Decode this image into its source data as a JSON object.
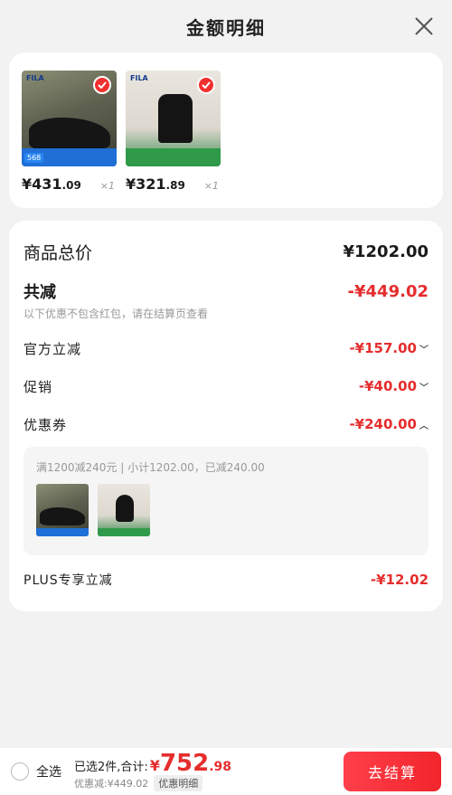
{
  "header": {
    "title": "金额明细"
  },
  "products": [
    {
      "brand": "FILA",
      "strip_tag": "568",
      "price_int": "¥431",
      "price_dec": ".09",
      "qty": "×1"
    },
    {
      "brand": "FILA",
      "strip_tag": "",
      "price_int": "¥321",
      "price_dec": ".89",
      "qty": "×1"
    }
  ],
  "summary": {
    "total_label": "商品总价",
    "total_value": "¥1202.00",
    "reduce_label": "共减",
    "reduce_value": "-¥449.02",
    "note": "以下优惠不包含红包，请在结算页查看",
    "official_label": "官方立减",
    "official_value": "-¥157.00",
    "promo_label": "促销",
    "promo_value": "-¥40.00",
    "coupon_label": "优惠券",
    "coupon_value": "-¥240.00",
    "coupon_detail": "满1200减240元 | 小计1202.00，已减240.00",
    "plus_label": "PLUS专享立减",
    "plus_value": "-¥12.02"
  },
  "footer": {
    "select_all": "全选",
    "selected_text": "已选2件,合计:",
    "yen": "¥",
    "total_int": "752",
    "total_dec": ".98",
    "discount_text": "优惠减:¥449.02",
    "discount_detail_btn": "优惠明细",
    "checkout_label": "去结算"
  },
  "colors": {
    "accent": "#e52d2d",
    "checkout": "#f2252c"
  }
}
